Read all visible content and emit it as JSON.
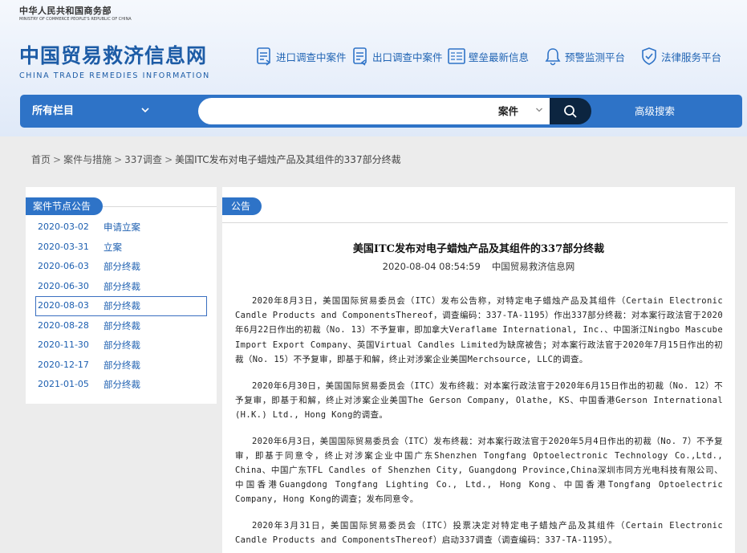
{
  "header": {
    "ministry_cn": "中华人民共和国商务部",
    "ministry_en": "MINISTRY OF COMMERCE PEOPLE'S REPUBLIC OF CHINA",
    "site_title_cn": "中国贸易救济信息网",
    "site_title_en": "CHINA TRADE REMEDIES INFORMATION",
    "nav": [
      {
        "label": "进口调查中案件",
        "icon": "import-case-icon"
      },
      {
        "label": "出口调查中案件",
        "icon": "export-case-icon"
      },
      {
        "label": "壁垒最新信息",
        "icon": "barrier-info-icon"
      },
      {
        "label": "预警监测平台",
        "icon": "bell-icon"
      },
      {
        "label": "法律服务平台",
        "icon": "shield-icon"
      }
    ]
  },
  "search": {
    "all_columns_label": "所有栏目",
    "query_value": "",
    "case_type_label": "案件",
    "advanced_label": "高级搜索"
  },
  "breadcrumb": {
    "items": [
      "首页",
      "案件与措施",
      "337调查"
    ],
    "current": "美国ITC发布对电子蜡烛产品及其组件的337部分终裁"
  },
  "sidebar": {
    "tag": "案件节点公告",
    "items": [
      {
        "date": "2020-03-02",
        "type": "申请立案"
      },
      {
        "date": "2020-03-31",
        "type": "立案"
      },
      {
        "date": "2020-06-03",
        "type": "部分终裁"
      },
      {
        "date": "2020-06-30",
        "type": "部分终裁"
      },
      {
        "date": "2020-08-03",
        "type": "部分终裁"
      },
      {
        "date": "2020-08-28",
        "type": "部分终裁"
      },
      {
        "date": "2020-11-30",
        "type": "部分终裁"
      },
      {
        "date": "2020-12-17",
        "type": "部分终裁"
      },
      {
        "date": "2021-01-05",
        "type": "部分终裁"
      }
    ],
    "active_index": 4
  },
  "article": {
    "tag": "公告",
    "title": "美国ITC发布对电子蜡烛产品及其组件的337部分终裁",
    "datetime": "2020-08-04 08:54:59",
    "source": "中国贸易救济信息网",
    "paragraphs": [
      "2020年8月3日，美国国际贸易委员会（ITC）发布公告称，对特定电子蜡烛产品及其组件（Certain Electronic Candle Products and ComponentsThereof，调查编码：337-TA-1195）作出337部分终裁：对本案行政法官于2020年6月22日作出的初裁（No. 13）不予复审，即加拿大Veraflame International, Inc.、中国浙江Ningbo Mascube Import Export Company、英国Virtual Candles Limited为缺席被告；对本案行政法官于2020年7月15日作出的初裁（No. 15）不予复审，即基于和解，终止对涉案企业美国Merchsource, LLC的调查。",
      "2020年6月30日，美国国际贸易委员会（ITC）发布终裁：对本案行政法官于2020年6月15日作出的初裁（No. 12）不予复审，即基于和解，终止对涉案企业美国The Gerson Company, Olathe, KS、中国香港Gerson International (H.K.) Ltd., Hong Kong的调查。",
      "2020年6月3日，美国国际贸易委员会（ITC）发布终裁：对本案行政法官于2020年5月4日作出的初裁（No. 7）不予复审，即基于同意令，终止对涉案企业中国广东Shenzhen Tongfang Optoelectronic Technology Co.,Ltd., China、中国广东TFL Candles of Shenzhen City, Guangdong Province,China深圳市同方光电科技有限公司、中国香港Guangdong Tongfang Lighting Co., Ltd., Hong Kong、中国香港Tongfang Optoelectric Company, Hong Kong的调查；发布同意令。",
      "2020年3月31日，美国国际贸易委员会（ITC）投票决定对特定电子蜡烛产品及其组件（Certain Electronic Candle Products and ComponentsThereof）启动337调查（调查编码：337-TA-1195）。"
    ]
  },
  "colors": {
    "brand_blue": "#2e73c7",
    "title_blue": "#1d5ca6",
    "search_button": "#0c2540"
  }
}
